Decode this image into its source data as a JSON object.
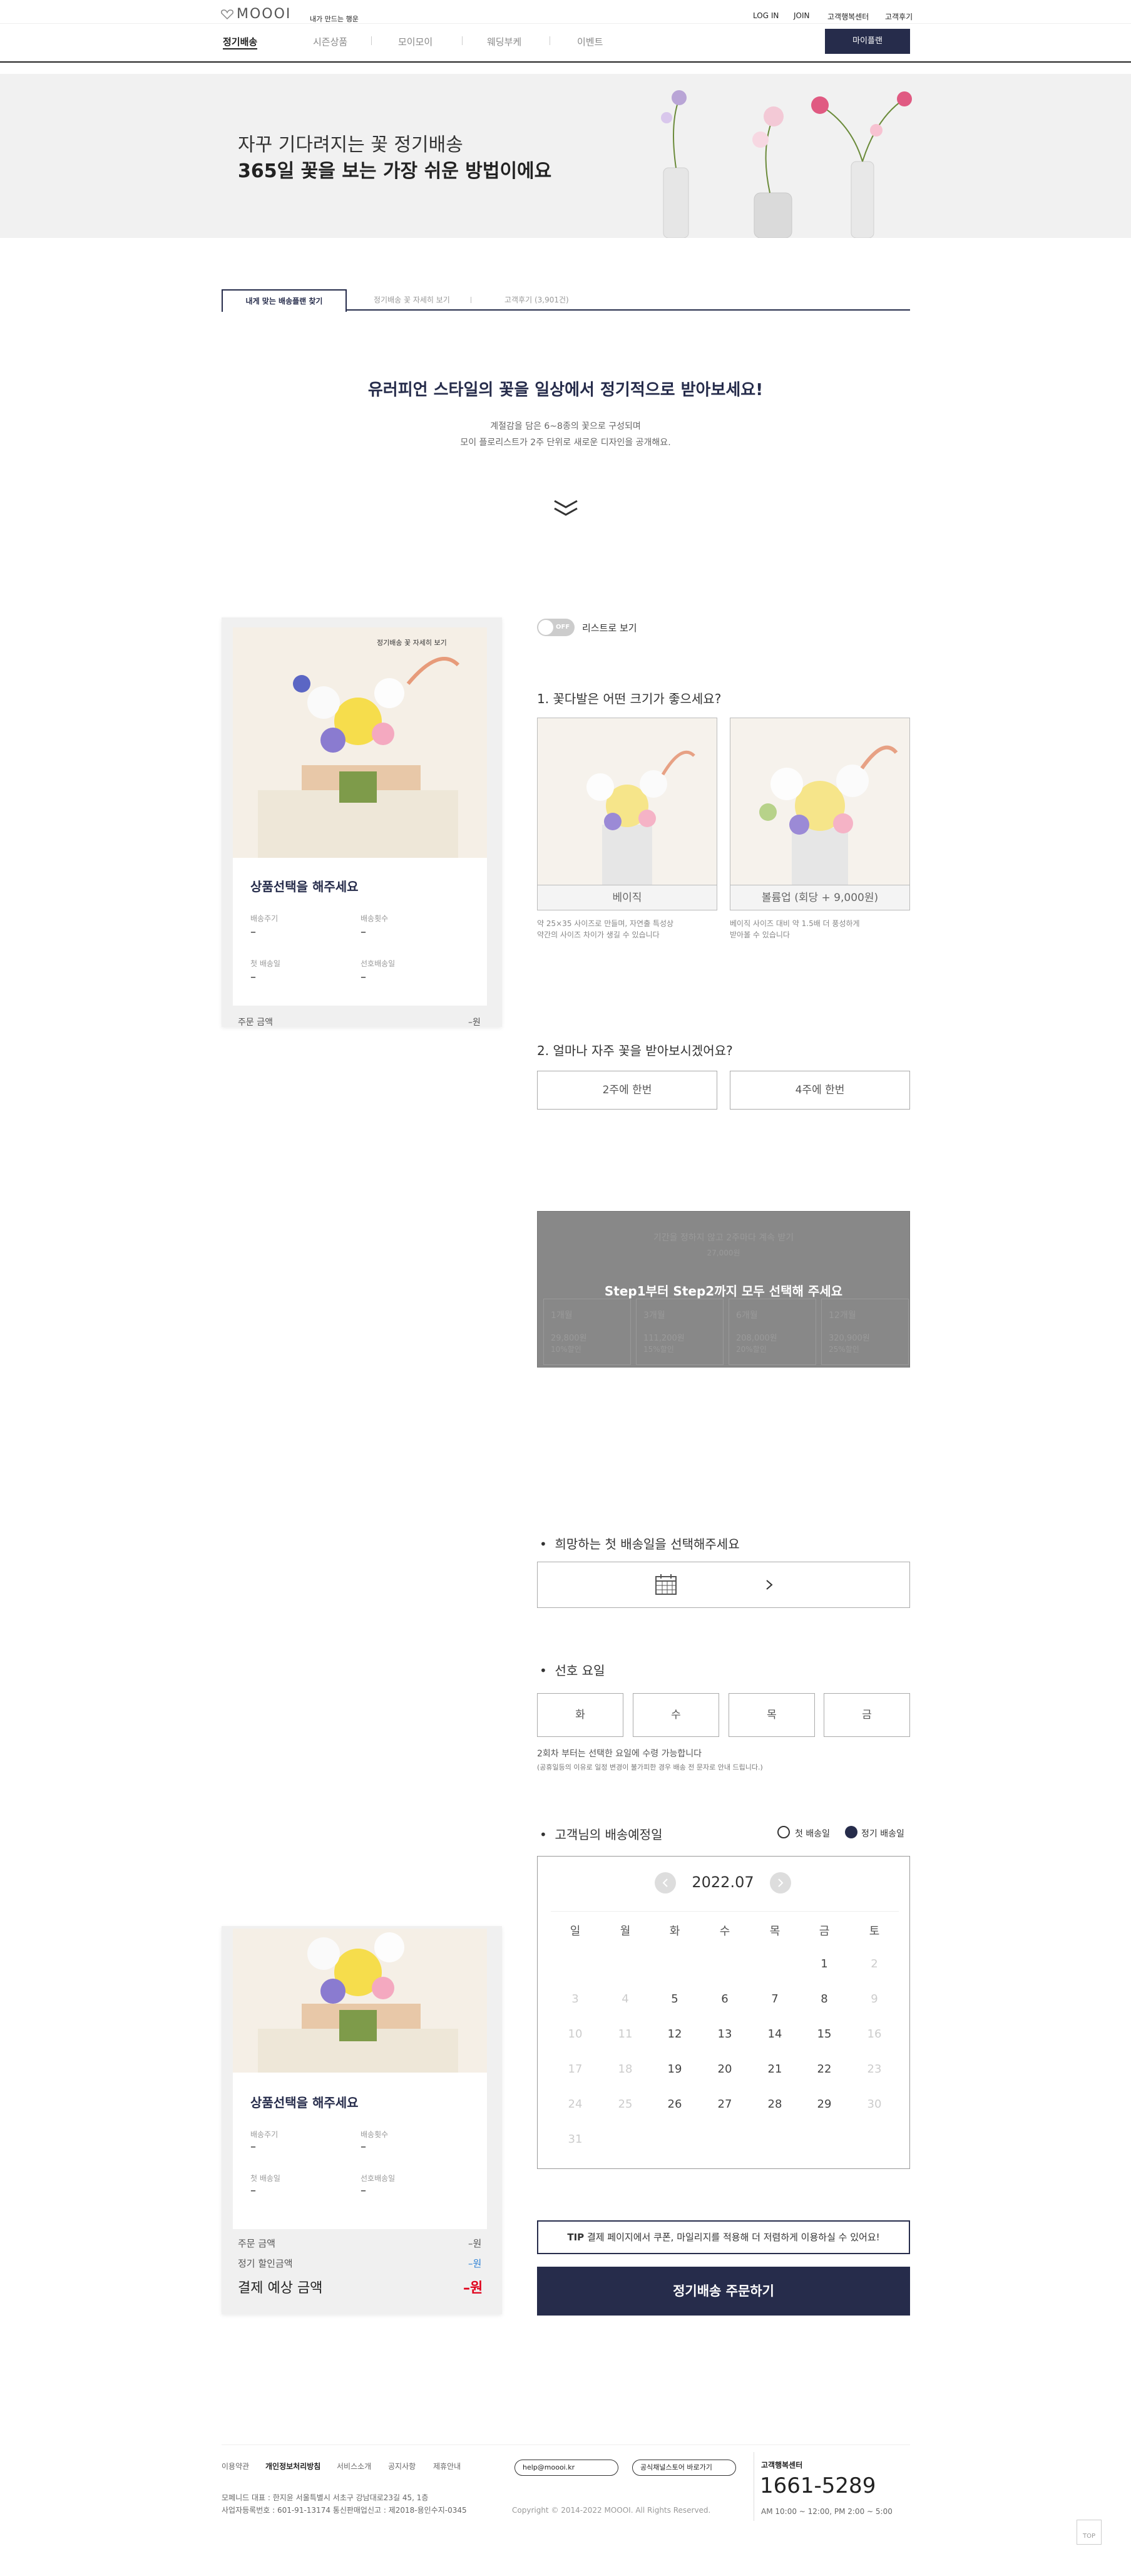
{
  "header": {
    "logo": "MOOOI",
    "logo_sub": "내가 만드는 행운",
    "links": [
      "LOG IN",
      "JOIN",
      "고객행복센터",
      "고객후기"
    ],
    "nav": [
      "정기배송",
      "시즌상품",
      "모이모이",
      "웨딩부케",
      "이벤트"
    ],
    "mypage": "마이플랜"
  },
  "banner": {
    "line1": "자꾸 기다려지는 꽃 정기배송",
    "line2": "365일 꽃을 보는 가장 쉬운 방법이에요"
  },
  "tabs": [
    "내게 맞는 배송플랜 찾기",
    "정기배송 꽃 자세히 보기",
    "고객후기 (3,901건)"
  ],
  "intro": {
    "title": "유러피언 스타일의 꽃을 일상에서 정기적으로 받아보세요!",
    "desc1": "계절감을 담은 6~8종의 꽃으로 구성되며",
    "desc2": "모이 플로리스트가 2주 단위로 새로운 디자인을 공개해요."
  },
  "summary": {
    "img_badge": "정기배송 꽃 자세히 보기",
    "title": "상품선택을 해주세요",
    "fields": [
      {
        "label": "배송주기",
        "value": "–"
      },
      {
        "label": "배송횟수",
        "value": "–"
      },
      {
        "label": "첫 배송일",
        "value": "–"
      },
      {
        "label": "선호배송일",
        "value": "–"
      }
    ],
    "order_amount_label": "주문 금액",
    "order_amount": "–원",
    "discount_label": "정기 할인금액",
    "discount": "–원",
    "expected_label": "결제 예상 금액",
    "expected": "–원"
  },
  "toggle": {
    "state": "OFF",
    "label": "리스트로 보기"
  },
  "step1": {
    "title": "1. 꽃다발은 어떤 크기가 좋으세요?",
    "options": [
      {
        "label": "베이직",
        "desc1": "약 25×35 사이즈로 만들며, 자연출 특성상",
        "desc2": "약간의 사이즈 차이가 생길 수 있습니다"
      },
      {
        "label": "볼륨업 (회당 + 9,000원)",
        "desc1": "베이직 사이즈 대비 약 1.5배 더 풍성하게",
        "desc2": "받아볼 수 있습니다"
      }
    ]
  },
  "step2": {
    "title": "2. 얼마나 자주 꽃을 받아보시겠어요?",
    "options": [
      "2주에 한번",
      "4주에 한번"
    ]
  },
  "overlay": {
    "message": "Step1부터 Step2까지 모두 선택해 주세요",
    "top1": "기간을 정하지 않고 2주마다 계속 받기",
    "top2": "27,000원",
    "plans": [
      {
        "name": "1개월",
        "price": "29,800원",
        "note": "10%할인"
      },
      {
        "name": "3개월",
        "price": "111,200원",
        "note": "15%할인"
      },
      {
        "name": "6개월",
        "price": "208,000원",
        "note": "20%할인"
      },
      {
        "name": "12개월",
        "price": "320,900원",
        "note": "25%할인"
      }
    ]
  },
  "first_delivery": {
    "title": "희망하는 첫 배송일을 선택해주세요"
  },
  "weekday": {
    "title": "선호 요일",
    "days": [
      "화",
      "수",
      "목",
      "금"
    ],
    "note1": "2회차 부터는 선택한 요일에 수령 가능합니다",
    "note2": "(공휴일등의 이유로 일정 변경이 불가피한 경우 배송 전 문자로 안내 드립니다.)"
  },
  "calendar": {
    "title": "고객님의 배송예정일",
    "legend_first": "첫 배송일",
    "legend_regular": "정기 배송일",
    "month": "2022.07",
    "weekdays": [
      "일",
      "월",
      "화",
      "수",
      "목",
      "금",
      "토"
    ],
    "weeks": [
      [
        "",
        "",
        "",
        "",
        "",
        "1",
        "2"
      ],
      [
        "3",
        "4",
        "5",
        "6",
        "7",
        "8",
        "9"
      ],
      [
        "10",
        "11",
        "12",
        "13",
        "14",
        "15",
        "16"
      ],
      [
        "17",
        "18",
        "19",
        "20",
        "21",
        "22",
        "23"
      ],
      [
        "24",
        "25",
        "26",
        "27",
        "28",
        "29",
        "30"
      ],
      [
        "31",
        "",
        "",
        "",
        "",
        "",
        ""
      ]
    ]
  },
  "tip": {
    "label": "TIP",
    "text": "결제 페이지에서 쿠폰, 마일리지를 적용해 더 저렴하게 이용하실 수 있어요!"
  },
  "order_button": "정기배송 주문하기",
  "footer": {
    "links": [
      "이용약관",
      "개인정보처리방침",
      "서비스소개",
      "공지사항",
      "제휴안내"
    ],
    "email_btn": "help@moooi.kr",
    "kakao_btn": "공식채널스토어 바로가기",
    "company1": "모페니드  대표 : 한지윤   서울특별시 서초구 강남대로23길 45, 1층",
    "company2": "사업자등록번호 : 601-91-13174   통신판매업신고 : 제2018-용인수지-0345",
    "copyright": "Copyright © 2014-2022 MOOOI. All Rights Reserved.",
    "cs_title": "고객행복센터",
    "cs_phone": "1661-5289",
    "cs_hours": "AM 10:00 ~ 12:00, PM 2:00 ~ 5:00",
    "top_btn": "TOP"
  },
  "colors": {
    "navy": "#262c4b",
    "accent": "#e0001b",
    "blue": "#2a7fd4",
    "overlay": "#888888"
  }
}
